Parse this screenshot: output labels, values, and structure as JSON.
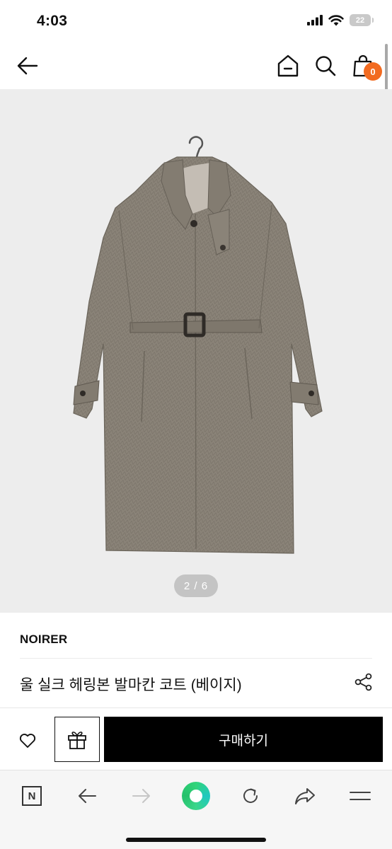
{
  "status_bar": {
    "time": "4:03",
    "battery": "22",
    "icons": [
      "cellular-signal-icon",
      "wifi-icon",
      "battery-icon"
    ]
  },
  "top_nav": {
    "icons": [
      "back-arrow-icon",
      "home-icon",
      "search-icon",
      "shopping-bag-icon"
    ],
    "cart_count": "0"
  },
  "gallery": {
    "current": "2",
    "total": "6",
    "indicator": "2 / 6"
  },
  "product": {
    "brand": "NOIRER",
    "title": "울 실크 헤링본 발마칸 코트 (베이지)"
  },
  "purchase_bar": {
    "buy_label": "구매하기",
    "icons": [
      "heart-icon",
      "gift-icon"
    ]
  },
  "browser_toolbar": {
    "naver_label": "N",
    "icons": [
      "naver-icon",
      "back-icon",
      "forward-icon",
      "green-dot-icon",
      "reload-icon",
      "share-icon",
      "menu-icon"
    ]
  },
  "colors": {
    "accent": "#f26b21",
    "buy_button": "#000000",
    "gallery_background": "#ededed",
    "coat": "#8a8378"
  }
}
